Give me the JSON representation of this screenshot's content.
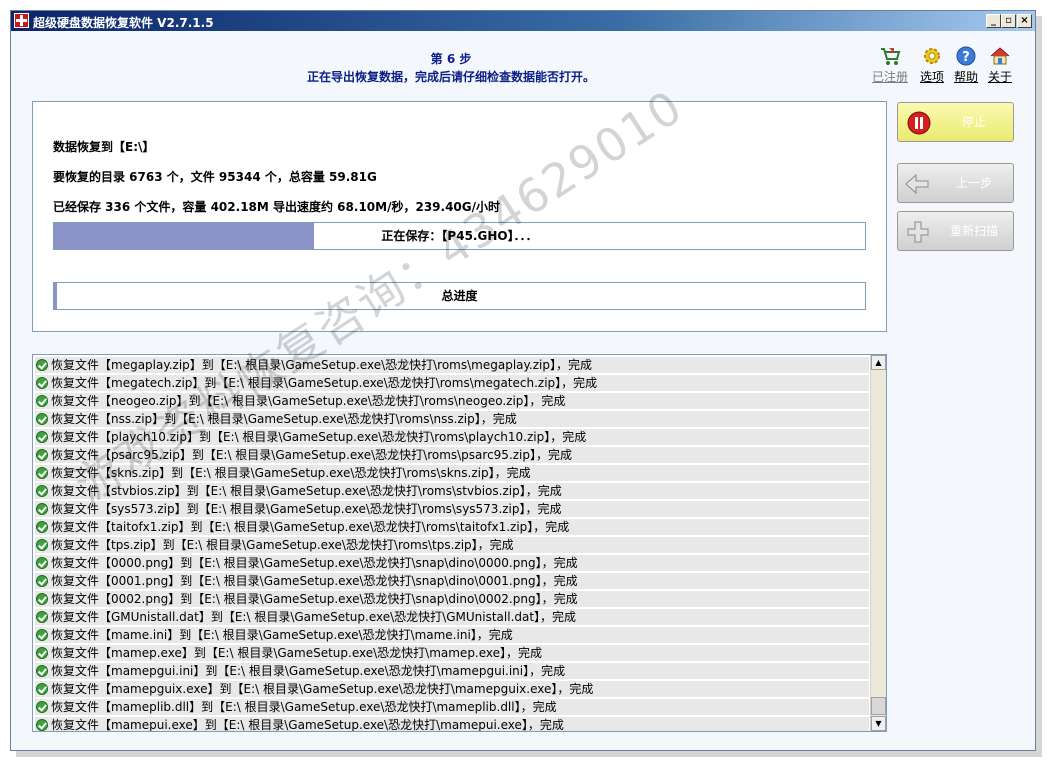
{
  "window": {
    "title": "超级硬盘数据恢复软件 V2.7.1.5",
    "controls": {
      "minimize": "_",
      "maximize": "▫",
      "close": "×"
    }
  },
  "header": {
    "step_title": "第 6 步",
    "step_desc": "正在导出恢复数据，完成后请仔细检查数据能否打开。"
  },
  "top_links": [
    {
      "label": "已注册",
      "icon": "cart-icon"
    },
    {
      "label": "选项",
      "icon": "gear-icon"
    },
    {
      "label": "帮助",
      "icon": "help-icon"
    },
    {
      "label": "关于",
      "icon": "home-icon"
    }
  ],
  "info": {
    "target": "数据恢复到【E:\\】",
    "totals": "要恢复的目录 6763 个，文件 95344 个，总容量 59.81G",
    "saved": "已经保存 336 个文件，容量 402.18M   导出速度约 68.10M/秒，239.40G/小时",
    "current_progress_label": "正在保存：【P45.GHO】．．．",
    "current_progress_fraction": 0.32,
    "total_progress_label": "总进度",
    "total_progress_fraction": 0.003
  },
  "side_buttons": [
    {
      "label": "停止",
      "icon": "stop-icon",
      "enabled": true
    },
    {
      "label": "上一步",
      "icon": "back-arrow-icon",
      "enabled": false
    },
    {
      "label": "重新扫描",
      "icon": "plus-icon",
      "enabled": false
    }
  ],
  "log_rows": [
    "恢复文件【megaplay.zip】到【E:\\ 根目录\\GameSetup.exe\\恐龙快打\\roms\\megaplay.zip】，完成",
    "恢复文件【megatech.zip】到【E:\\ 根目录\\GameSetup.exe\\恐龙快打\\roms\\megatech.zip】，完成",
    "恢复文件【neogeo.zip】到【E:\\ 根目录\\GameSetup.exe\\恐龙快打\\roms\\neogeo.zip】，完成",
    "恢复文件【nss.zip】到【E:\\ 根目录\\GameSetup.exe\\恐龙快打\\roms\\nss.zip】，完成",
    "恢复文件【playch10.zip】到【E:\\ 根目录\\GameSetup.exe\\恐龙快打\\roms\\playch10.zip】，完成",
    "恢复文件【psarc95.zip】到【E:\\ 根目录\\GameSetup.exe\\恐龙快打\\roms\\psarc95.zip】，完成",
    "恢复文件【skns.zip】到【E:\\ 根目录\\GameSetup.exe\\恐龙快打\\roms\\skns.zip】，完成",
    "恢复文件【stvbios.zip】到【E:\\ 根目录\\GameSetup.exe\\恐龙快打\\roms\\stvbios.zip】，完成",
    "恢复文件【sys573.zip】到【E:\\ 根目录\\GameSetup.exe\\恐龙快打\\roms\\sys573.zip】，完成",
    "恢复文件【taitofx1.zip】到【E:\\ 根目录\\GameSetup.exe\\恐龙快打\\roms\\taitofx1.zip】，完成",
    "恢复文件【tps.zip】到【E:\\ 根目录\\GameSetup.exe\\恐龙快打\\roms\\tps.zip】，完成",
    "恢复文件【0000.png】到【E:\\ 根目录\\GameSetup.exe\\恐龙快打\\snap\\dino\\0000.png】，完成",
    "恢复文件【0001.png】到【E:\\ 根目录\\GameSetup.exe\\恐龙快打\\snap\\dino\\0001.png】，完成",
    "恢复文件【0002.png】到【E:\\ 根目录\\GameSetup.exe\\恐龙快打\\snap\\dino\\0002.png】，完成",
    "恢复文件【GMUnistall.dat】到【E:\\ 根目录\\GameSetup.exe\\恐龙快打\\GMUnistall.dat】，完成",
    "恢复文件【mame.ini】到【E:\\ 根目录\\GameSetup.exe\\恐龙快打\\mame.ini】，完成",
    "恢复文件【mamep.exe】到【E:\\ 根目录\\GameSetup.exe\\恐龙快打\\mamep.exe】，完成",
    "恢复文件【mamepgui.ini】到【E:\\ 根目录\\GameSetup.exe\\恐龙快打\\mamepgui.ini】，完成",
    "恢复文件【mamepguix.exe】到【E:\\ 根目录\\GameSetup.exe\\恐龙快打\\mamepguix.exe】，完成",
    "恢复文件【mameplib.dll】到【E:\\ 根目录\\GameSetup.exe\\恐龙快打\\mameplib.dll】，完成",
    "恢复文件【mamepui.exe】到【E:\\ 根目录\\GameSetup.exe\\恐龙快打\\mamepui.exe】，完成"
  ],
  "watermark": "游戏资料恢复咨询：434629010",
  "colors": {
    "titlebar": "#0b246a",
    "heading_text": "#0a1f86",
    "progress_fill": "#8c93c8",
    "stop_button": "#f2f28c",
    "ok_icon": "#3ea33e"
  }
}
